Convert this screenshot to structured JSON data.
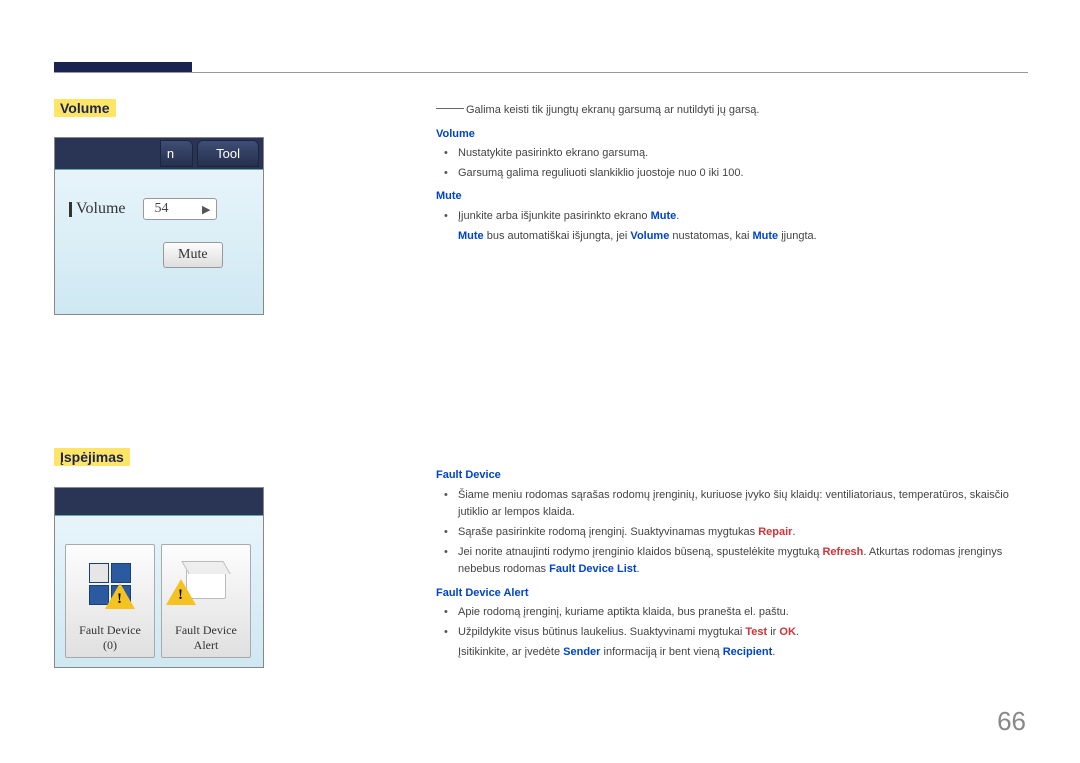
{
  "headings": {
    "volume": "Volume",
    "ispejimas": "Įspėjimas"
  },
  "thumb_vol": {
    "tab_n": "n",
    "tab_tool": "Tool",
    "label": "Volume",
    "value": "54",
    "mute_btn": "Mute"
  },
  "thumb_isp": {
    "card1_line1": "Fault Device",
    "card1_line2": "(0)",
    "card2_line1": "Fault Device",
    "card2_line2": "Alert"
  },
  "intro_line": "Galima keisti tik įjungtų ekranų garsumą ar nutildyti jų garsą.",
  "vol_section": {
    "title": "Volume",
    "b1": "Nustatykite pasirinkto ekrano garsumą.",
    "b2": "Garsumą galima reguliuoti slankiklio juostoje nuo 0 iki 100."
  },
  "mute_section": {
    "title": "Mute",
    "b1_pre": "Įjunkite arba išjunkite pasirinkto ekrano ",
    "b1_kw": "Mute",
    "b1_post": ".",
    "line2_kw1": "Mute",
    "line2_mid1": " bus automatiškai išjungta, jei ",
    "line2_kw2": "Volume",
    "line2_mid2": " nustatomas, kai ",
    "line2_kw3": "Mute",
    "line2_end": " įjungta."
  },
  "fault_device": {
    "title": "Fault Device",
    "b1": "Šiame meniu rodomas sąrašas rodomų įrenginių, kuriuose įvyko šių klaidų: ventiliatoriaus, temperatūros, skaisčio jutiklio ar lempos klaida.",
    "b2_pre": "Sąraše pasirinkite rodomą įrenginį. Suaktyvinamas mygtukas ",
    "b2_kw": "Repair",
    "b2_post": ".",
    "b3_pre": "Jei norite atnaujinti rodymo įrenginio klaidos būseną, spustelėkite mygtuką ",
    "b3_kw": "Refresh",
    "b3_mid": ". Atkurtas rodomas įrenginys nebebus rodomas ",
    "b3_kw2": "Fault Device List",
    "b3_post": "."
  },
  "fault_alert": {
    "title": "Fault Device Alert",
    "b1": "Apie rodomą įrenginį, kuriame aptikta klaida, bus pranešta el. paštu.",
    "b2_pre": "Užpildykite visus būtinus laukelius. Suaktyvinami mygtukai ",
    "b2_kw1": "Test",
    "b2_mid": " ir ",
    "b2_kw2": "OK",
    "b2_post": ".",
    "line3_pre": "Įsitikinkite, ar įvedėte ",
    "line3_kw1": "Sender",
    "line3_mid": " informaciją ir bent vieną ",
    "line3_kw2": "Recipient",
    "line3_post": "."
  },
  "page_number": "66"
}
